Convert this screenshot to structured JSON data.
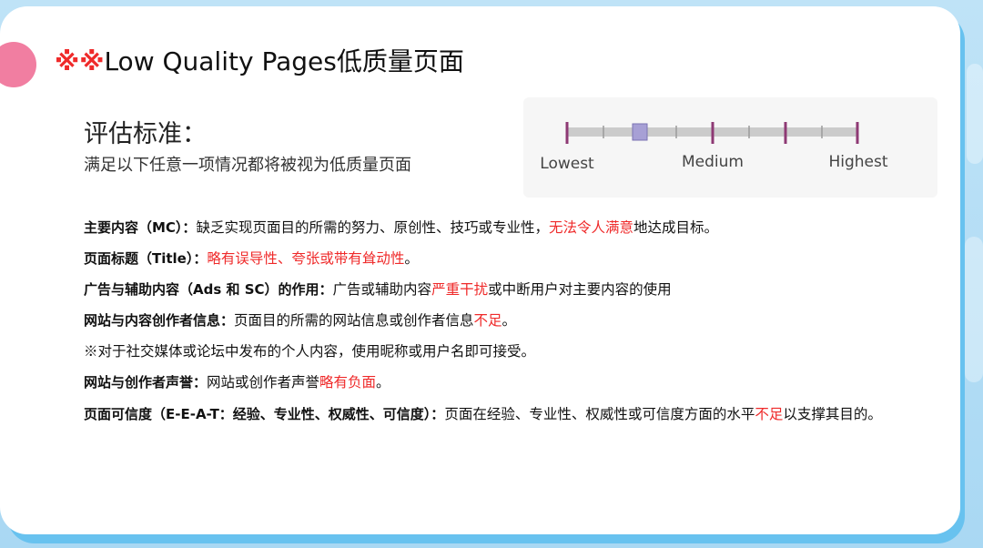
{
  "slide": {
    "title_mark": "※※",
    "title_text": "Low Quality Pages低质量页面",
    "criteria_heading": "评估标准：",
    "criteria_subtitle": "满足以下任意一项情况都将被视为低质量页面"
  },
  "scale": {
    "labels": {
      "low": "Lowest",
      "medium": "Medium",
      "high": "Highest"
    },
    "selected_fraction": 0.25
  },
  "criteria": [
    {
      "label": "主要内容（MC）：",
      "text_before": "缺乏实现页面目的所需的努力、原创性、技巧或专业性，",
      "highlight": "无法令人满意",
      "text_after": "地达成目标。"
    },
    {
      "label": "页面标题（Title）：",
      "text_before": "",
      "highlight": "略有误导性、夸张或带有耸动性",
      "text_after": "。"
    },
    {
      "label": "广告与辅助内容（Ads 和 SC）的作用：",
      "text_before": "广告或辅助内容",
      "highlight": "严重干扰",
      "text_after": "或中断用户对主要内容的使用"
    },
    {
      "label": "网站与内容创作者信息：",
      "text_before": "页面目的所需的网站信息或创作者信息",
      "highlight": "不足",
      "text_after": "。"
    },
    {
      "label": "",
      "text_before": "※对于社交媒体或论坛中发布的个人内容，使用昵称或用户名即可接受。",
      "highlight": "",
      "text_after": ""
    },
    {
      "label": "网站与创作者声誉：",
      "text_before": "网站或创作者声誉",
      "highlight": "略有负面",
      "text_after": "。"
    },
    {
      "label": "页面可信度（E-E-A-T：经验、专业性、权威性、可信度）：",
      "text_before": "页面在经验、专业性、权威性或可信度方面的水平",
      "highlight": "不足",
      "text_after": "以支撑其目的。"
    }
  ],
  "colors": {
    "highlight": "#ef2a2a",
    "accent_dot": "#f17ea1",
    "slide_shadow": "#68c2ef",
    "scale_track": "#cbcbcb",
    "scale_marker": "#8e3974",
    "scale_selector": "#a7a0d5"
  }
}
